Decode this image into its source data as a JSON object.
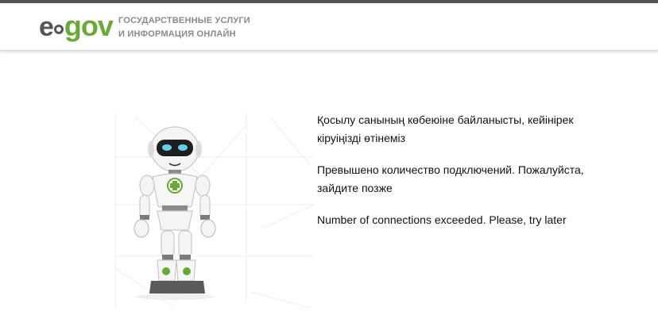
{
  "header": {
    "logo": {
      "prefix": "e",
      "word": "gov"
    },
    "tagline_line1": "ГОСУДАРСТВЕННЫЕ УСЛУГИ",
    "tagline_line2": "И ИНФОРМАЦИЯ ОНЛАЙН"
  },
  "colors": {
    "brand_green": "#6aa83a",
    "brand_gray": "#555555",
    "top_bar": "#555555"
  },
  "illustration": {
    "name": "robot-mascot"
  },
  "messages": {
    "kazakh": "Қосылу санының көбеюіне байланысты, кейінірек кіруіңізді өтінеміз",
    "russian": "Превышено количество подключений. Пожалуйста, зайдите позже",
    "english": "Number of connections exceeded. Please, try later"
  }
}
